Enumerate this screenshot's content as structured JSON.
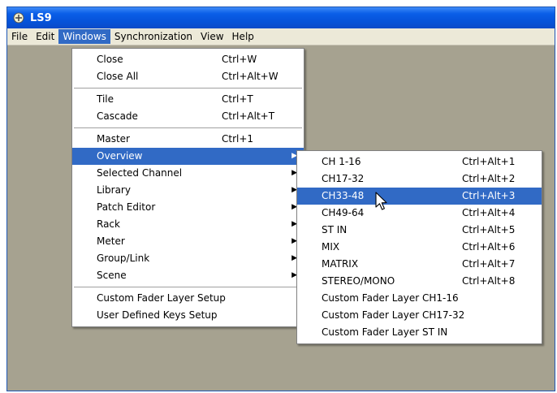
{
  "window": {
    "title": "LS9"
  },
  "menubar": {
    "items": [
      {
        "label": "File",
        "active": false
      },
      {
        "label": "Edit",
        "active": false
      },
      {
        "label": "Windows",
        "active": true
      },
      {
        "label": "Synchronization",
        "active": false
      },
      {
        "label": "View",
        "active": false
      },
      {
        "label": "Help",
        "active": false
      }
    ]
  },
  "windows_menu": {
    "items": [
      {
        "type": "item",
        "label": "Close",
        "shortcut": "Ctrl+W"
      },
      {
        "type": "item",
        "label": "Close All",
        "shortcut": "Ctrl+Alt+W"
      },
      {
        "type": "separator"
      },
      {
        "type": "item",
        "label": "Tile",
        "shortcut": "Ctrl+T"
      },
      {
        "type": "item",
        "label": "Cascade",
        "shortcut": "Ctrl+Alt+T"
      },
      {
        "type": "separator"
      },
      {
        "type": "item",
        "label": "Master",
        "shortcut": "Ctrl+1"
      },
      {
        "type": "item",
        "label": "Overview",
        "submenu": true,
        "selected": true
      },
      {
        "type": "item",
        "label": "Selected Channel",
        "submenu": true
      },
      {
        "type": "item",
        "label": "Library",
        "submenu": true
      },
      {
        "type": "item",
        "label": "Patch Editor",
        "submenu": true
      },
      {
        "type": "item",
        "label": "Rack",
        "submenu": true
      },
      {
        "type": "item",
        "label": "Meter",
        "submenu": true
      },
      {
        "type": "item",
        "label": "Group/Link",
        "submenu": true
      },
      {
        "type": "item",
        "label": "Scene",
        "submenu": true
      },
      {
        "type": "separator"
      },
      {
        "type": "item",
        "label": "Custom Fader Layer Setup"
      },
      {
        "type": "item",
        "label": "User Defined Keys Setup"
      }
    ]
  },
  "overview_submenu": {
    "items": [
      {
        "label": "CH 1-16",
        "shortcut": "Ctrl+Alt+1"
      },
      {
        "label": "CH17-32",
        "shortcut": "Ctrl+Alt+2"
      },
      {
        "label": "CH33-48",
        "shortcut": "Ctrl+Alt+3",
        "selected": true
      },
      {
        "label": "CH49-64",
        "shortcut": "Ctrl+Alt+4"
      },
      {
        "label": "ST IN",
        "shortcut": "Ctrl+Alt+5"
      },
      {
        "label": "MIX",
        "shortcut": "Ctrl+Alt+6"
      },
      {
        "label": "MATRIX",
        "shortcut": "Ctrl+Alt+7"
      },
      {
        "label": "STEREO/MONO",
        "shortcut": "Ctrl+Alt+8"
      },
      {
        "label": "Custom Fader Layer CH1-16"
      },
      {
        "label": "Custom Fader Layer CH17-32"
      },
      {
        "label": "Custom Fader Layer ST IN"
      }
    ]
  },
  "colors": {
    "titlebar": "#0a5ee8",
    "highlight": "#316ac5",
    "client_background": "#a6a290",
    "menubar": "#ece9d8"
  },
  "icons": {
    "app": "ls9-app-icon",
    "cursor": "mouse-pointer-icon",
    "submenu": "submenu-arrow-icon"
  }
}
